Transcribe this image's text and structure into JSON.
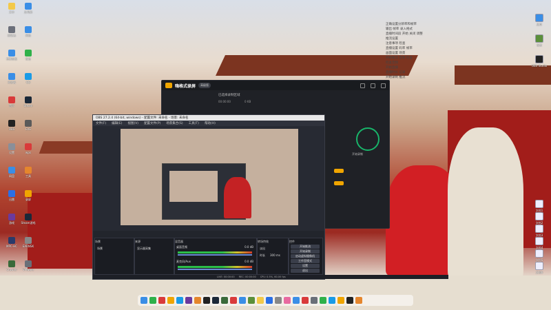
{
  "desktop": {
    "left_icons": [
      {
        "label": "文件",
        "color": "#f3c94a"
      },
      {
        "label": "此电脑",
        "color": "#3a8ee6"
      },
      {
        "label": "回收站",
        "color": "#6b6f7a"
      },
      {
        "label": "网络",
        "color": "#3a8ee6"
      },
      {
        "label": "控制面板",
        "color": "#3a8ee6"
      },
      {
        "label": "微信",
        "color": "#2fb14a"
      },
      {
        "label": "浏览器",
        "color": "#3a8ee6"
      },
      {
        "label": "QQ",
        "color": "#1a9be6"
      },
      {
        "label": "音乐",
        "color": "#d93a3a"
      },
      {
        "label": "Steam",
        "color": "#1b2838"
      },
      {
        "label": "OBS",
        "color": "#222"
      },
      {
        "label": "EVE",
        "color": "#5a5a5a"
      },
      {
        "label": "设置",
        "color": "#8a8f99"
      },
      {
        "label": "wps",
        "color": "#d93a3a"
      },
      {
        "label": "网盘",
        "color": "#3a8ee6"
      },
      {
        "label": "工具",
        "color": "#e5862d"
      },
      {
        "label": "迅雷",
        "color": "#2a6fe6"
      },
      {
        "label": "录屏",
        "color": "#f0a500"
      },
      {
        "label": "游戏",
        "color": "#6b3a9e"
      },
      {
        "label": "Steam游戏",
        "color": "#1b2838"
      },
      {
        "label": "MPC-HC",
        "color": "#2a3a6a"
      },
      {
        "label": "EARNSK",
        "color": "#888"
      },
      {
        "label": "Crawler",
        "color": "#3a6a3a"
      },
      {
        "label": "VMware",
        "color": "#6a6f78"
      }
    ],
    "right_icons": [
      {
        "label": "应用",
        "color": "#3a8ee6"
      },
      {
        "label": "设置",
        "color": "#5b8f3a"
      },
      {
        "label": "OBS Studio",
        "color": "#222"
      },
      {
        "label": "文档1",
        "color": "#eeeeff"
      },
      {
        "label": "文档2",
        "color": "#eeeeff"
      },
      {
        "label": "文档3",
        "color": "#eeeeff"
      },
      {
        "label": "文档4",
        "color": "#eeeeff"
      },
      {
        "label": "文档5",
        "color": "#eeeeff"
      },
      {
        "label": "文档6",
        "color": "#eeeeff"
      }
    ],
    "notes": [
      "正确设置分辨率和帧率",
      "输出 帧率 录入格式",
      "",
      "直播时间段 开始 关闭 调整",
      "推流设置",
      "注意事项 检查",
      "直播设置 码率 帧率",
      "画面设置 场景",
      "开始推流 音频 检查",
      "检查音频",
      "开始直播",
      "直播时长 记录",
      "",
      "开始录制 推流"
    ]
  },
  "recorder": {
    "brand": "嗨格式录屏",
    "badge": "高级版",
    "mode_label": "已选择录制区域",
    "record_label": "开始录制",
    "time": "00:00:00",
    "size": "0 KB"
  },
  "obs": {
    "title": "OBS 27.2.4 (64-bit, windows) - 配置文件: 未命名 - 场景: 未命名",
    "menu": [
      "文件(F)",
      "编辑(E)",
      "视图(V)",
      "配置文件(P)",
      "场景集合(S)",
      "工具(T)",
      "帮助(H)"
    ],
    "docks": {
      "scenes_title": "场景",
      "sources_title": "来源",
      "mixer_title": "混音器",
      "transitions_title": "转场特效",
      "controls_title": "控件"
    },
    "scene_item": "场景",
    "source_item": "显示器采集",
    "mixer": [
      {
        "name": "桌面音频",
        "db": "0.0 dB"
      },
      {
        "name": "麦克风/Aux",
        "db": "0.0 dB"
      }
    ],
    "transition": {
      "type": "淡出",
      "duration_label": "时长",
      "duration": "300 ms"
    },
    "controls": [
      "开始推流",
      "开始录制",
      "启动虚拟摄像机",
      "工作室模式",
      "设置",
      "退出"
    ],
    "status": [
      "LIVE: 00:00:00",
      "REC: 00:00:00",
      "CPU: 0.5%, 60.00 fps"
    ]
  },
  "taskbar": {
    "colors": [
      "#3a8ee6",
      "#2fb14a",
      "#d93a3a",
      "#f0a500",
      "#1a9be6",
      "#6b3a9e",
      "#e5862d",
      "#222",
      "#1b2838",
      "#3a6a3a",
      "#d93a3a",
      "#3a8ee6",
      "#5b8f3a",
      "#f3c94a",
      "#2a6fe6",
      "#888",
      "#e86aa0",
      "#3a8ee6",
      "#d93a3a",
      "#6a6f78",
      "#2fb14a",
      "#1a9be6",
      "#f0a500",
      "#222",
      "#e5862d"
    ]
  }
}
